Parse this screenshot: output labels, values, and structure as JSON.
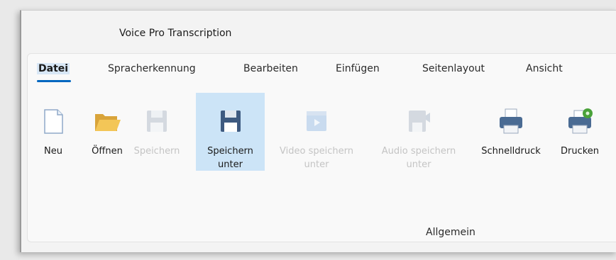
{
  "window": {
    "title": "Voice Pro Transcription"
  },
  "tabs": [
    {
      "label": "Datei",
      "active": true
    },
    {
      "label": "Spracherkennung",
      "active": false
    },
    {
      "label": "Bearbeiten",
      "active": false
    },
    {
      "label": "Einfügen",
      "active": false
    },
    {
      "label": "Seitenlayout",
      "active": false
    },
    {
      "label": "Ansicht",
      "active": false
    }
  ],
  "ribbon": {
    "buttons": [
      {
        "label": "Neu",
        "icon": "new-document-icon",
        "enabled": true
      },
      {
        "label": "Öffnen",
        "icon": "folder-open-icon",
        "enabled": true
      },
      {
        "label": "Speichern",
        "icon": "save-icon",
        "enabled": false
      },
      {
        "label_line1": "Speichern",
        "label_line2": "unter",
        "icon": "save-as-icon",
        "enabled": true,
        "selected": true
      },
      {
        "label_line1": "Video speichern",
        "label_line2": "unter",
        "icon": "video-save-icon",
        "enabled": false
      },
      {
        "label_line1": "Audio speichern",
        "label_line2": "unter",
        "icon": "audio-save-icon",
        "enabled": false
      },
      {
        "label": "Schnelldruck",
        "icon": "printer-icon",
        "enabled": true
      },
      {
        "label": "Drucken",
        "icon": "printer-settings-icon",
        "enabled": true
      }
    ],
    "group_label": "Allgemein"
  },
  "colors": {
    "accent": "#0067c0",
    "selected": "#cce4f7",
    "disabled_text": "#c4c4c4"
  }
}
